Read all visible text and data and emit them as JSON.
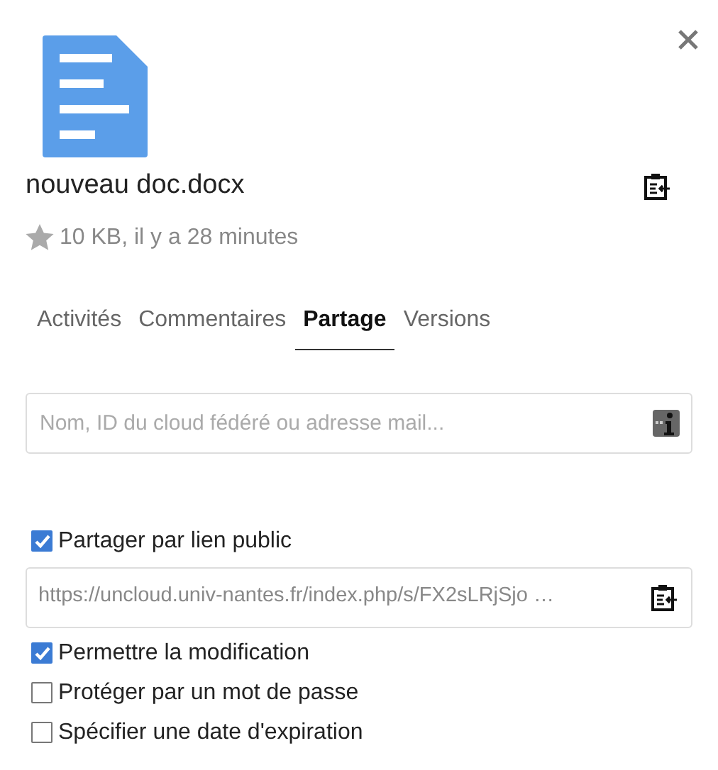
{
  "file": {
    "name": "nouveau doc.docx",
    "starred": false,
    "meta": "10 KB, il y a 28 minutes"
  },
  "tabs": [
    {
      "label": "Activités",
      "selected": false
    },
    {
      "label": "Commentaires",
      "selected": false
    },
    {
      "label": "Partage",
      "selected": true
    },
    {
      "label": "Versions",
      "selected": false
    }
  ],
  "share_search": {
    "placeholder": "Nom, ID du cloud fédéré ou adresse mail..."
  },
  "public_link": {
    "label": "Partager par lien public",
    "checked": true,
    "url": "https://uncloud.univ-nantes.fr/index.php/s/FX2sLRjSjo …"
  },
  "options": [
    {
      "label": "Permettre la modification",
      "checked": true
    },
    {
      "label": "Protéger par un mot de passe",
      "checked": false
    },
    {
      "label": "Spécifier une date d'expiration",
      "checked": false
    }
  ]
}
